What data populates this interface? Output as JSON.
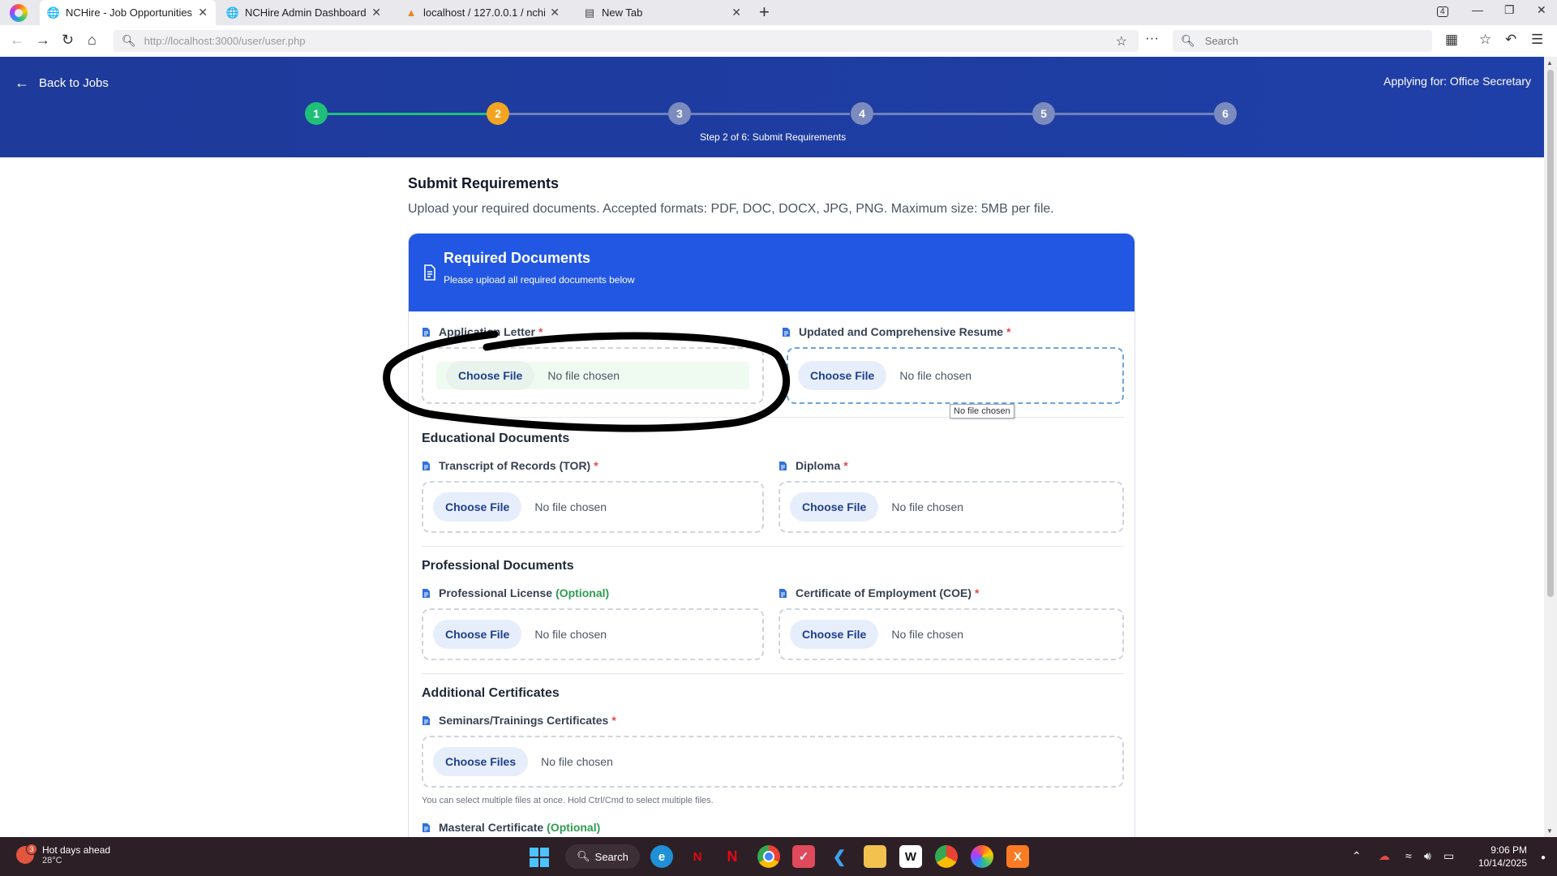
{
  "browser": {
    "tabs": [
      {
        "label": "NCHire - Job Opportunities",
        "icon": "globe-icon",
        "active": true
      },
      {
        "label": "NCHire Admin Dashboard",
        "icon": "globe-icon",
        "active": false
      },
      {
        "label": "localhost / 127.0.0.1 / nchire /",
        "icon": "phpmyadmin-icon",
        "active": false
      },
      {
        "label": "New Tab",
        "icon": "new-tab-page-icon",
        "active": false
      }
    ],
    "tab_count_badge": "4",
    "url_host": "http://localhost",
    "url_path": ":3000/user/user.php",
    "search_placeholder": "Search"
  },
  "header": {
    "back_label": "Back to Jobs",
    "applying_for": "Applying for: Office Secretary",
    "steps": [
      {
        "num": "1",
        "state": "done"
      },
      {
        "num": "2",
        "state": "current"
      },
      {
        "num": "3",
        "state": "todo"
      },
      {
        "num": "4",
        "state": "todo"
      },
      {
        "num": "5",
        "state": "todo"
      },
      {
        "num": "6",
        "state": "todo"
      }
    ],
    "step_caption": "Step 2 of 6: Submit Requirements"
  },
  "page": {
    "title": "Submit Requirements",
    "subtitle": "Upload your required documents. Accepted formats: PDF, DOC, DOCX, JPG, PNG. Maximum size: 5MB per file."
  },
  "card": {
    "title": "Required Documents",
    "subtitle": "Please upload all required documents below"
  },
  "fields": {
    "application_letter": {
      "label": "Application Letter",
      "required_mark": "*",
      "button": "Choose File",
      "status": "No file chosen"
    },
    "resume": {
      "label": "Updated and Comprehensive Resume",
      "required_mark": "*",
      "button": "Choose File",
      "status": "No file chosen"
    },
    "tor": {
      "label": "Transcript of Records (TOR)",
      "required_mark": "*",
      "button": "Choose File",
      "status": "No file chosen"
    },
    "diploma": {
      "label": "Diploma",
      "required_mark": "*",
      "button": "Choose File",
      "status": "No file chosen"
    },
    "license": {
      "label": "Professional License",
      "optional_mark": "(Optional)",
      "button": "Choose File",
      "status": "No file chosen"
    },
    "coe": {
      "label": "Certificate of Employment (COE)",
      "required_mark": "*",
      "button": "Choose File",
      "status": "No file chosen"
    },
    "seminars": {
      "label": "Seminars/Trainings Certificates",
      "required_mark": "*",
      "button": "Choose Files",
      "status": "No file chosen",
      "hint": "You can select multiple files at once. Hold Ctrl/Cmd to select multiple files."
    },
    "masteral": {
      "label": "Masteral Certificate",
      "optional_mark": "(Optional)"
    }
  },
  "sections": {
    "educational": "Educational Documents",
    "professional": "Professional Documents",
    "additional": "Additional Certificates"
  },
  "tooltip": "No file chosen",
  "colors": {
    "header_bg": "#1e3a9a",
    "card_head_bg": "#2157e3",
    "step_done": "#1fbf7a",
    "step_current": "#f3a521",
    "step_todo": "#7b8bbd",
    "required": "#e5484d",
    "optional": "#2e9d4f",
    "annotation_stroke": "#000000"
  },
  "taskbar": {
    "weather_title": "Hot days ahead",
    "weather_temp": "28°C",
    "weather_badge": "3",
    "search_label": "Search",
    "time": "9:06 PM",
    "date": "10/14/2025"
  }
}
